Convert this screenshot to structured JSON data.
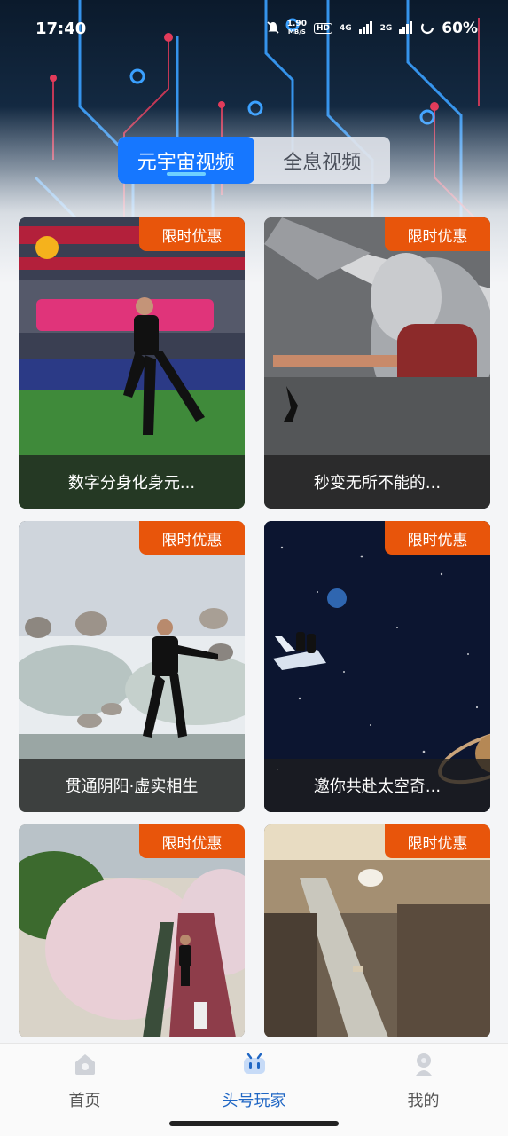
{
  "status_bar": {
    "time": "17:40",
    "net_speed_value": "1.90",
    "net_speed_unit": "MB/S",
    "hd_label": "HD",
    "sim1_tag": "4G",
    "sim2_tag": "2G",
    "battery": "60%"
  },
  "tabs": [
    {
      "label": "元宇宙视频",
      "active": true
    },
    {
      "label": "全息视频",
      "active": false
    }
  ],
  "cards": [
    {
      "badge": "限时优惠",
      "title": "数字分身化身元..."
    },
    {
      "badge": "限时优惠",
      "title": "秒变无所不能的..."
    },
    {
      "badge": "限时优惠",
      "title": "贯通阴阳·虚实相生"
    },
    {
      "badge": "限时优惠",
      "title": "邀你共赴太空奇..."
    },
    {
      "badge": "限时优惠",
      "title": ""
    },
    {
      "badge": "限时优惠",
      "title": ""
    }
  ],
  "bottom_nav": [
    {
      "label": "首页",
      "icon": "home-icon",
      "active": false
    },
    {
      "label": "头号玩家",
      "icon": "player-icon",
      "active": true
    },
    {
      "label": "我的",
      "icon": "profile-icon",
      "active": false
    }
  ],
  "colors": {
    "accent": "#1677ff",
    "badge": "#e8550b",
    "nav_active": "#1f66c4"
  }
}
